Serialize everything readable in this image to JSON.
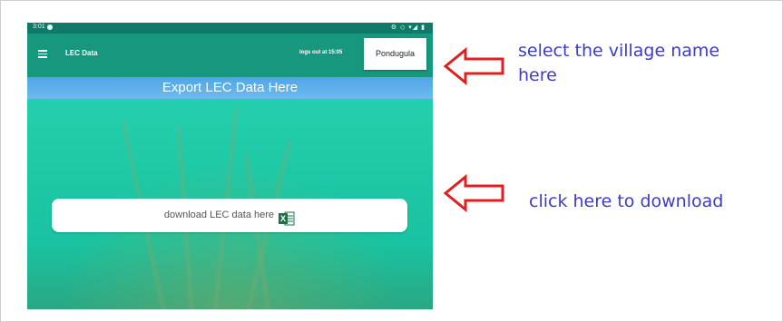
{
  "statusbar": {
    "time": "3:01",
    "icons": "⚙ ◇ ▾◢ ▮"
  },
  "appbar": {
    "title": "LEC Data",
    "logout_text": "logs out at 15:05",
    "village_selected": "Pondugula"
  },
  "banner": {
    "text": "Export LEC Data Here"
  },
  "download": {
    "label": "download LEC data here",
    "icon": "excel-icon"
  },
  "annotations": {
    "select_village": "select the village name here",
    "download_hint": "click here to download"
  },
  "colors": {
    "appbar": "#17977d",
    "statusbar": "#0f7a66",
    "banner": "#5aaee9",
    "background": "#17c7a0",
    "arrow": "#e02020",
    "annotation_text": "#3c3cc8"
  }
}
